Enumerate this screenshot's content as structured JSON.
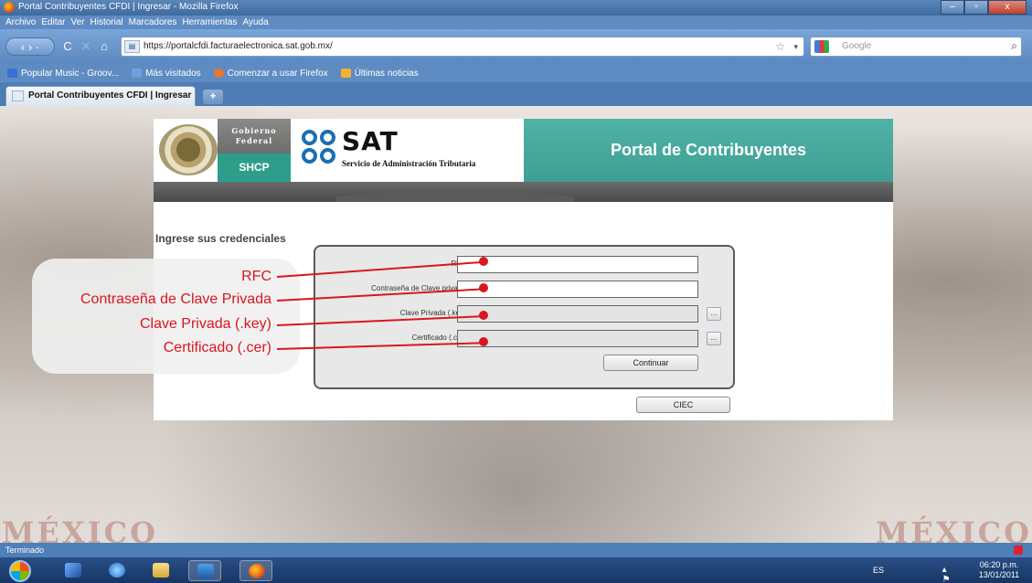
{
  "window": {
    "title": "Portal Contribuyentes CFDI | Ingresar - Mozilla Firefox",
    "minimize": "–",
    "maximize": "▫",
    "close": "x"
  },
  "menu": [
    "Archivo",
    "Editar",
    "Ver",
    "Historial",
    "Marcadores",
    "Herramientas",
    "Ayuda"
  ],
  "nav": {
    "url": "https://portalcfdi.facturaelectronica.sat.gob.mx/",
    "search_placeholder": "Google"
  },
  "bookmarks": [
    {
      "label": "Popular Music - Groov...",
      "color": "#3a6fd8"
    },
    {
      "label": "Más visitados",
      "color": "#6f9fe0"
    },
    {
      "label": "Comenzar a usar Firefox",
      "color": "#e8792a"
    },
    {
      "label": "Últimas noticias",
      "color": "#f2b233"
    }
  ],
  "tab": {
    "label": "Portal Contribuyentes CFDI | Ingresar",
    "newtab": "+"
  },
  "portal": {
    "gobierno_line1": "Gobierno",
    "gobierno_line2": "Federal",
    "shcp": "SHCP",
    "sat": "SAT",
    "sat_sub": "Servicio de Administración Tributaria",
    "banner": "Portal de Contribuyentes",
    "cred_title": "Ingrese sus credenciales",
    "form": {
      "rfc_label": "RFC:",
      "pwd_label": "Contraseña de Clave privada:",
      "key_label": "Clave Privada (.key):",
      "cer_label": "Certificado (.cer):",
      "browse": "...",
      "continue": "Continuar"
    },
    "ciec": "CIEC"
  },
  "callouts": [
    "RFC",
    "Contraseña de Clave Privada",
    "Clave Privada (.key)",
    "Certificado (.cer)"
  ],
  "background_text": {
    "left": "MÉXICO",
    "right": "MÉXICO"
  },
  "status": "Terminado",
  "tray": {
    "lang": "ES",
    "time": "06:20 p.m.",
    "date": "13/01/2011"
  },
  "colors": {
    "accent_red": "#d8171e",
    "sat_teal": "#3f9e92",
    "sat_blue": "#1a6fb3"
  }
}
